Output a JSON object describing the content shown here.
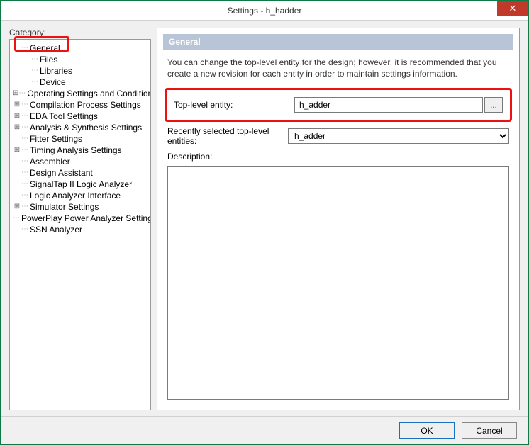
{
  "window": {
    "title": "Settings - h_hadder"
  },
  "sidebar": {
    "category_label": "Category:",
    "items": [
      {
        "label": "General",
        "level": 0,
        "expand": "",
        "highlight": true
      },
      {
        "label": "Files",
        "level": 1,
        "expand": ""
      },
      {
        "label": "Libraries",
        "level": 1,
        "expand": ""
      },
      {
        "label": "Device",
        "level": 1,
        "expand": ""
      },
      {
        "label": "Operating Settings and Conditions",
        "level": 0,
        "expand": "+"
      },
      {
        "label": "Compilation Process Settings",
        "level": 0,
        "expand": "+"
      },
      {
        "label": "EDA Tool Settings",
        "level": 0,
        "expand": "+"
      },
      {
        "label": "Analysis & Synthesis Settings",
        "level": 0,
        "expand": "+"
      },
      {
        "label": "Fitter Settings",
        "level": 0,
        "expand": ""
      },
      {
        "label": "Timing Analysis Settings",
        "level": 0,
        "expand": "+"
      },
      {
        "label": "Assembler",
        "level": 0,
        "expand": ""
      },
      {
        "label": "Design Assistant",
        "level": 0,
        "expand": ""
      },
      {
        "label": "SignalTap II Logic Analyzer",
        "level": 0,
        "expand": ""
      },
      {
        "label": "Logic Analyzer Interface",
        "level": 0,
        "expand": ""
      },
      {
        "label": "Simulator Settings",
        "level": 0,
        "expand": "+"
      },
      {
        "label": "PowerPlay Power Analyzer Settings",
        "level": 0,
        "expand": ""
      },
      {
        "label": "SSN Analyzer",
        "level": 0,
        "expand": ""
      }
    ]
  },
  "panel": {
    "header": "General",
    "intro": "You can change the top-level entity for the design; however, it is recommended that you create a new revision for each entity in order to maintain settings information.",
    "top_level_label": "Top-level entity:",
    "top_level_value": "h_adder",
    "browse_label": "...",
    "recent_label": "Recently selected top-level entities:",
    "recent_value": "h_adder",
    "description_label": "Description:"
  },
  "footer": {
    "ok": "OK",
    "cancel": "Cancel"
  }
}
